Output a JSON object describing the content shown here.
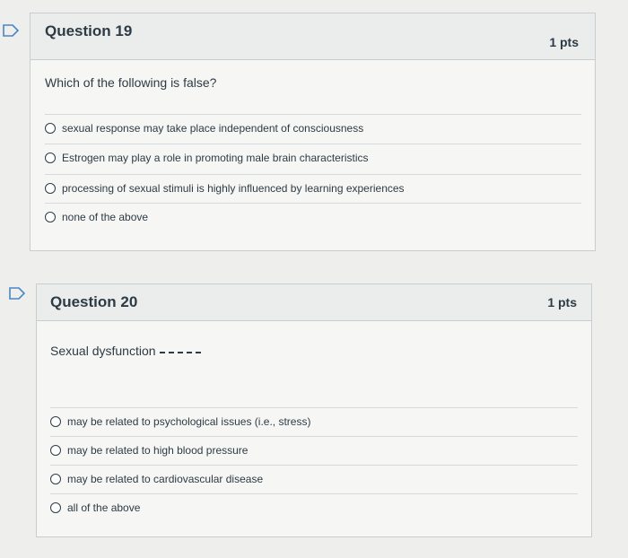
{
  "questions": [
    {
      "title": "Question 19",
      "points": "1 pts",
      "prompt": "Which of the following is false?",
      "answers": [
        "sexual response may take place independent of consciousness",
        "Estrogen may play a role in promoting male brain characteristics",
        "processing of sexual stimuli is highly influenced by learning experiences",
        "none of the above"
      ]
    },
    {
      "title": "Question 20",
      "points": "1 pts",
      "prompt": "Sexual dysfunction",
      "answers": [
        "may be related to psychological issues (i.e., stress)",
        "may be related to high blood pressure",
        "may be related to cardiovascular disease",
        "all of the above"
      ]
    }
  ],
  "colors": {
    "flag": "#4a86c5",
    "text": "#2d3b45"
  }
}
